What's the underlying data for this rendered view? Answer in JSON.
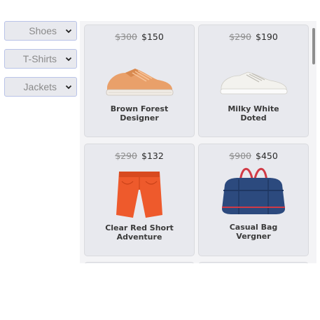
{
  "filters": [
    {
      "label": "Shoes"
    },
    {
      "label": "T-Shirts"
    },
    {
      "label": "Jackets"
    }
  ],
  "products": [
    {
      "old_price": "$300",
      "price": "$150",
      "name_line1": "Brown Forest",
      "name_line2": "Designer",
      "image": "tan-sneaker"
    },
    {
      "old_price": "$290",
      "price": "$190",
      "name_line1": "Milky White",
      "name_line2": "Doted",
      "image": "white-sneaker"
    },
    {
      "old_price": "$290",
      "price": "$132",
      "name_line1": "Clear Red Short",
      "name_line2": "Adventure",
      "image": "red-shorts"
    },
    {
      "old_price": "$900",
      "price": "$450",
      "name_line1": "Casual Bag",
      "name_line2": "Vergner",
      "image": "duffel-bag"
    }
  ],
  "colors": {
    "card_bg": "#e8e9ee",
    "select_border": "#b9c3e8",
    "tan": "#e9a06a",
    "red": "#ee5a2c",
    "navy": "#2c4a7e"
  }
}
